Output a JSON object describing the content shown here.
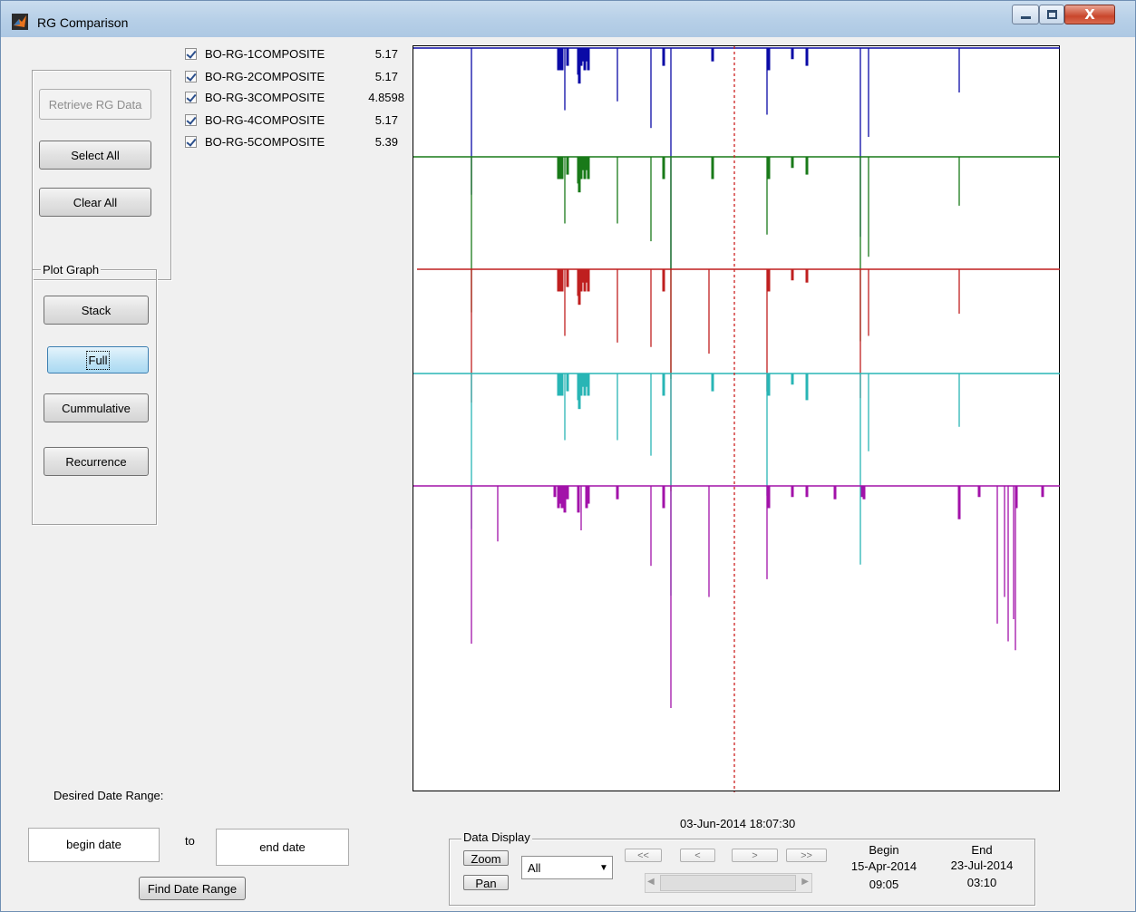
{
  "window": {
    "title": "RG Comparison",
    "close_glyph": "X"
  },
  "left_panel": {
    "retrieve": "Retrieve RG Data",
    "select_all": "Select All",
    "clear_all": "Clear All"
  },
  "plot_graph": {
    "label": "Plot Graph",
    "stack": "Stack",
    "full": "Full",
    "cummulative": "Cummulative",
    "recurrence": "Recurrence"
  },
  "gauges": [
    {
      "name": "BO-RG-1COMPOSITE",
      "value": "5.17",
      "checked": true,
      "color": "#0a0aa6"
    },
    {
      "name": "BO-RG-2COMPOSITE",
      "value": "5.17",
      "checked": true,
      "color": "#197a19"
    },
    {
      "name": "BO-RG-3COMPOSITE",
      "value": "4.8598",
      "checked": true,
      "color": "#bf1f1f"
    },
    {
      "name": "BO-RG-4COMPOSITE",
      "value": "5.17",
      "checked": true,
      "color": "#28b5b5"
    },
    {
      "name": "BO-RG-5COMPOSITE",
      "value": "5.39",
      "checked": true,
      "color": "#a212a9"
    }
  ],
  "date_range": {
    "label": "Desired Date Range:",
    "begin_placeholder": "begin date",
    "to": "to",
    "end_placeholder": "end date",
    "find": "Find Date Range"
  },
  "cursor_time": "03-Jun-2014 18:07:30",
  "data_display": {
    "label": "Data Display",
    "zoom": "Zoom",
    "pan": "Pan",
    "select_value": "All",
    "nav_first": "<<",
    "nav_prev": "<",
    "nav_next": ">",
    "nav_last": ">>",
    "begin_label": "Begin",
    "begin_date": "15-Apr-2014",
    "begin_time": "09:05",
    "end_label": "End",
    "end_date": "23-Jul-2014",
    "end_time": "03:10"
  },
  "chart_data": {
    "type": "bar",
    "layout": "stacked-offset",
    "x_range": [
      "15-Apr-2014 09:05",
      "23-Jul-2014 03:10"
    ],
    "cursor_x": "03-Jun-2014 18:07:30",
    "series": [
      {
        "name": "BO-RG-1COMPOSITE",
        "color": "#0a0aa6",
        "bars": [
          [
            64,
            0.66
          ],
          [
            160,
            0.1
          ],
          [
            162,
            0.1
          ],
          [
            164,
            0.1
          ],
          [
            167,
            0.28
          ],
          [
            170,
            0.08
          ],
          [
            182,
            0.12
          ],
          [
            183,
            0.16
          ],
          [
            185,
            0.08
          ],
          [
            187,
            0.06
          ],
          [
            189,
            0.1
          ],
          [
            191,
            0.06
          ],
          [
            193,
            0.1
          ],
          [
            225,
            0.24
          ],
          [
            262,
            0.36
          ],
          [
            276,
            0.08
          ],
          [
            284,
            1.0
          ],
          [
            330,
            0.06
          ],
          [
            390,
            0.3
          ],
          [
            392,
            0.1
          ],
          [
            418,
            0.05
          ],
          [
            434,
            0.08
          ],
          [
            493,
            0.85
          ],
          [
            502,
            0.4
          ],
          [
            602,
            0.2
          ]
        ]
      },
      {
        "name": "BO-RG-2COMPOSITE",
        "color": "#197a19",
        "bars": [
          [
            64,
            0.7
          ],
          [
            160,
            0.1
          ],
          [
            162,
            0.1
          ],
          [
            164,
            0.1
          ],
          [
            167,
            0.3
          ],
          [
            170,
            0.08
          ],
          [
            182,
            0.12
          ],
          [
            183,
            0.16
          ],
          [
            185,
            0.1
          ],
          [
            187,
            0.06
          ],
          [
            189,
            0.1
          ],
          [
            191,
            0.06
          ],
          [
            193,
            0.1
          ],
          [
            225,
            0.3
          ],
          [
            262,
            0.38
          ],
          [
            276,
            0.1
          ],
          [
            284,
            1.0
          ],
          [
            330,
            0.1
          ],
          [
            390,
            0.35
          ],
          [
            392,
            0.1
          ],
          [
            418,
            0.05
          ],
          [
            434,
            0.08
          ],
          [
            493,
            0.83
          ],
          [
            502,
            0.45
          ],
          [
            602,
            0.22
          ]
        ]
      },
      {
        "name": "BO-RG-3COMPOSITE",
        "color": "#bf1f1f",
        "bars": [
          [
            64,
            0.6
          ],
          [
            160,
            0.1
          ],
          [
            162,
            0.1
          ],
          [
            164,
            0.1
          ],
          [
            167,
            0.3
          ],
          [
            170,
            0.08
          ],
          [
            182,
            0.12
          ],
          [
            183,
            0.16
          ],
          [
            185,
            0.1
          ],
          [
            187,
            0.06
          ],
          [
            189,
            0.1
          ],
          [
            191,
            0.06
          ],
          [
            193,
            0.1
          ],
          [
            225,
            0.33
          ],
          [
            262,
            0.35
          ],
          [
            276,
            0.1
          ],
          [
            284,
            1.0
          ],
          [
            326,
            0.38
          ],
          [
            390,
            0.55
          ],
          [
            392,
            0.1
          ],
          [
            418,
            0.05
          ],
          [
            434,
            0.06
          ],
          [
            493,
            0.58
          ],
          [
            502,
            0.3
          ],
          [
            602,
            0.2
          ]
        ]
      },
      {
        "name": "BO-RG-4COMPOSITE",
        "color": "#28b5b5",
        "bars": [
          [
            64,
            0.7
          ],
          [
            160,
            0.1
          ],
          [
            162,
            0.1
          ],
          [
            164,
            0.1
          ],
          [
            167,
            0.3
          ],
          [
            170,
            0.08
          ],
          [
            182,
            0.12
          ],
          [
            183,
            0.16
          ],
          [
            185,
            0.1
          ],
          [
            187,
            0.06
          ],
          [
            189,
            0.1
          ],
          [
            191,
            0.06
          ],
          [
            193,
            0.1
          ],
          [
            225,
            0.3
          ],
          [
            262,
            0.37
          ],
          [
            276,
            0.1
          ],
          [
            284,
            1.0
          ],
          [
            330,
            0.08
          ],
          [
            390,
            0.55
          ],
          [
            392,
            0.1
          ],
          [
            418,
            0.05
          ],
          [
            434,
            0.12
          ],
          [
            493,
            0.86
          ],
          [
            502,
            0.35
          ],
          [
            602,
            0.24
          ]
        ]
      },
      {
        "name": "BO-RG-5COMPOSITE",
        "color": "#a212a9",
        "bars": [
          [
            64,
            0.71
          ],
          [
            93,
            0.25
          ],
          [
            156,
            0.05
          ],
          [
            160,
            0.1
          ],
          [
            162,
            0.08
          ],
          [
            164,
            0.1
          ],
          [
            167,
            0.12
          ],
          [
            170,
            0.06
          ],
          [
            182,
            0.12
          ],
          [
            185,
            0.2
          ],
          [
            191,
            0.1
          ],
          [
            193,
            0.08
          ],
          [
            225,
            0.06
          ],
          [
            262,
            0.36
          ],
          [
            276,
            0.1
          ],
          [
            284,
            1.0
          ],
          [
            326,
            0.5
          ],
          [
            390,
            0.42
          ],
          [
            392,
            0.1
          ],
          [
            418,
            0.05
          ],
          [
            434,
            0.05
          ],
          [
            465,
            0.06
          ],
          [
            495,
            0.05
          ],
          [
            497,
            0.06
          ],
          [
            602,
            0.15
          ],
          [
            624,
            0.05
          ],
          [
            644,
            0.62
          ],
          [
            652,
            0.5
          ],
          [
            656,
            0.7
          ],
          [
            662,
            0.6
          ],
          [
            664,
            0.74
          ],
          [
            665,
            0.1
          ],
          [
            694,
            0.05
          ]
        ]
      }
    ]
  }
}
